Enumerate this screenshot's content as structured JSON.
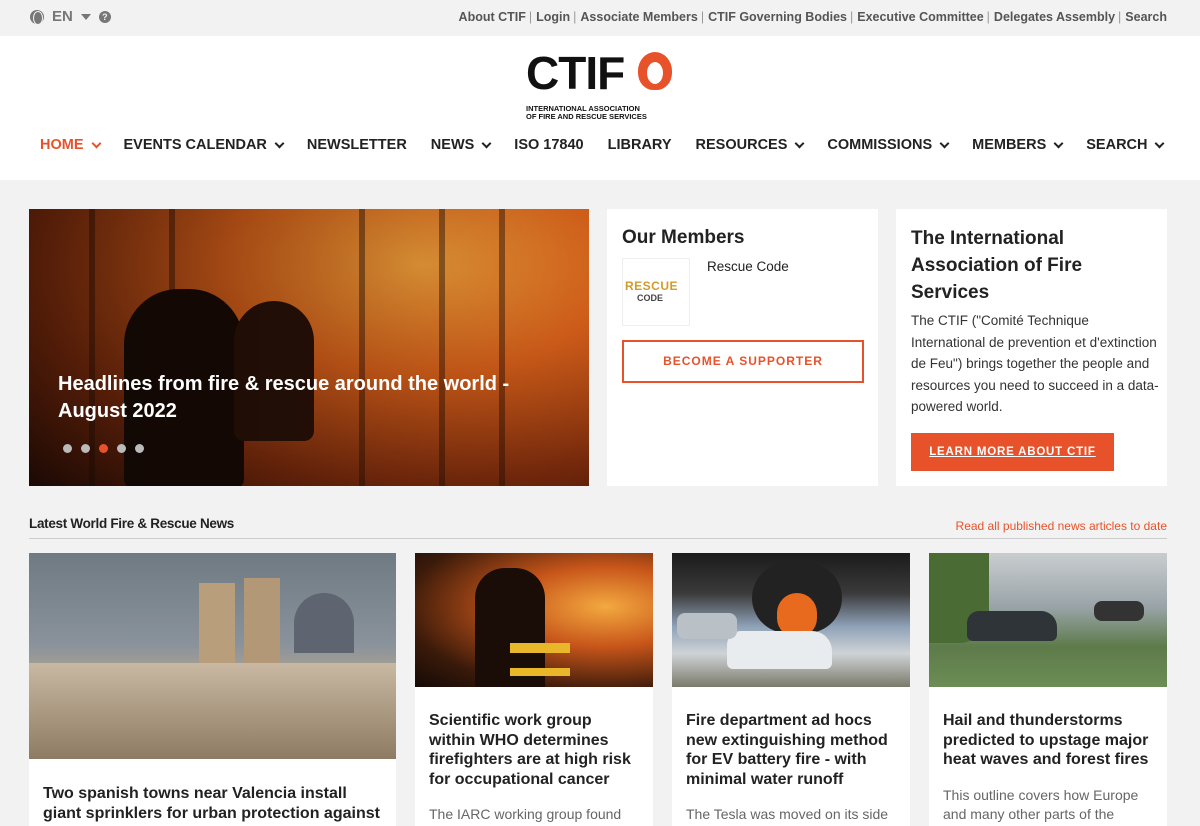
{
  "utility": {
    "language": "EN",
    "links": [
      "About CTIF",
      "Login",
      "Associate Members",
      "CTIF Governing Bodies",
      "Executive Committee",
      "Delegates Assembly",
      "Search"
    ]
  },
  "logo": {
    "word": "CTIF",
    "tagline_1": "INTERNATIONAL ASSOCIATION",
    "tagline_2": "OF FIRE AND RESCUE SERVICES"
  },
  "nav": [
    {
      "label": "HOME",
      "dropdown": true,
      "active": true
    },
    {
      "label": "EVENTS CALENDAR",
      "dropdown": true
    },
    {
      "label": "NEWSLETTER",
      "dropdown": false
    },
    {
      "label": "NEWS",
      "dropdown": true
    },
    {
      "label": "ISO 17840",
      "dropdown": false
    },
    {
      "label": "LIBRARY",
      "dropdown": false
    },
    {
      "label": "RESOURCES",
      "dropdown": true
    },
    {
      "label": "COMMISSIONS",
      "dropdown": true
    },
    {
      "label": "MEMBERS",
      "dropdown": true
    },
    {
      "label": "SEARCH",
      "dropdown": true
    }
  ],
  "hero": {
    "title": "Headlines from fire & rescue around the world - August 2022",
    "slide_count": 5,
    "active_slide": 3
  },
  "members": {
    "title": "Our Members",
    "member_name": "Rescue Code",
    "member_logo_text_1": "RESCUE",
    "member_logo_text_2": "CODE",
    "cta": "BECOME A SUPPORTER"
  },
  "about": {
    "title": "The International Association of Fire Services",
    "body": "The CTIF (\"Comité Technique International de prevention et d'extinction de Feu\") brings together the people and resources you need to succeed in a data-powered world.",
    "cta": "LEARN MORE ABOUT CTIF"
  },
  "news_section": {
    "title": "Latest World Fire & Rescue News",
    "link": "Read all published news articles to date"
  },
  "news": [
    {
      "title": "Two spanish towns near Valencia install giant sprinklers for urban protection against",
      "excerpt": ""
    },
    {
      "title": "Scientific work group within WHO determines firefighters are at high risk for occupational cancer",
      "excerpt": "The IARC working group found"
    },
    {
      "title": "Fire department ad hocs new extinguishing method for EV battery fire - with minimal water runoff",
      "excerpt": "The Tesla was moved on its side"
    },
    {
      "title": "Hail and thunderstorms predicted to upstage major heat waves and forest fires",
      "excerpt": "This outline covers how Europe and many other parts of the"
    }
  ],
  "colors": {
    "accent": "#e8522a",
    "background": "#f2f2f2",
    "card": "#ffffff",
    "text": "#222222"
  }
}
